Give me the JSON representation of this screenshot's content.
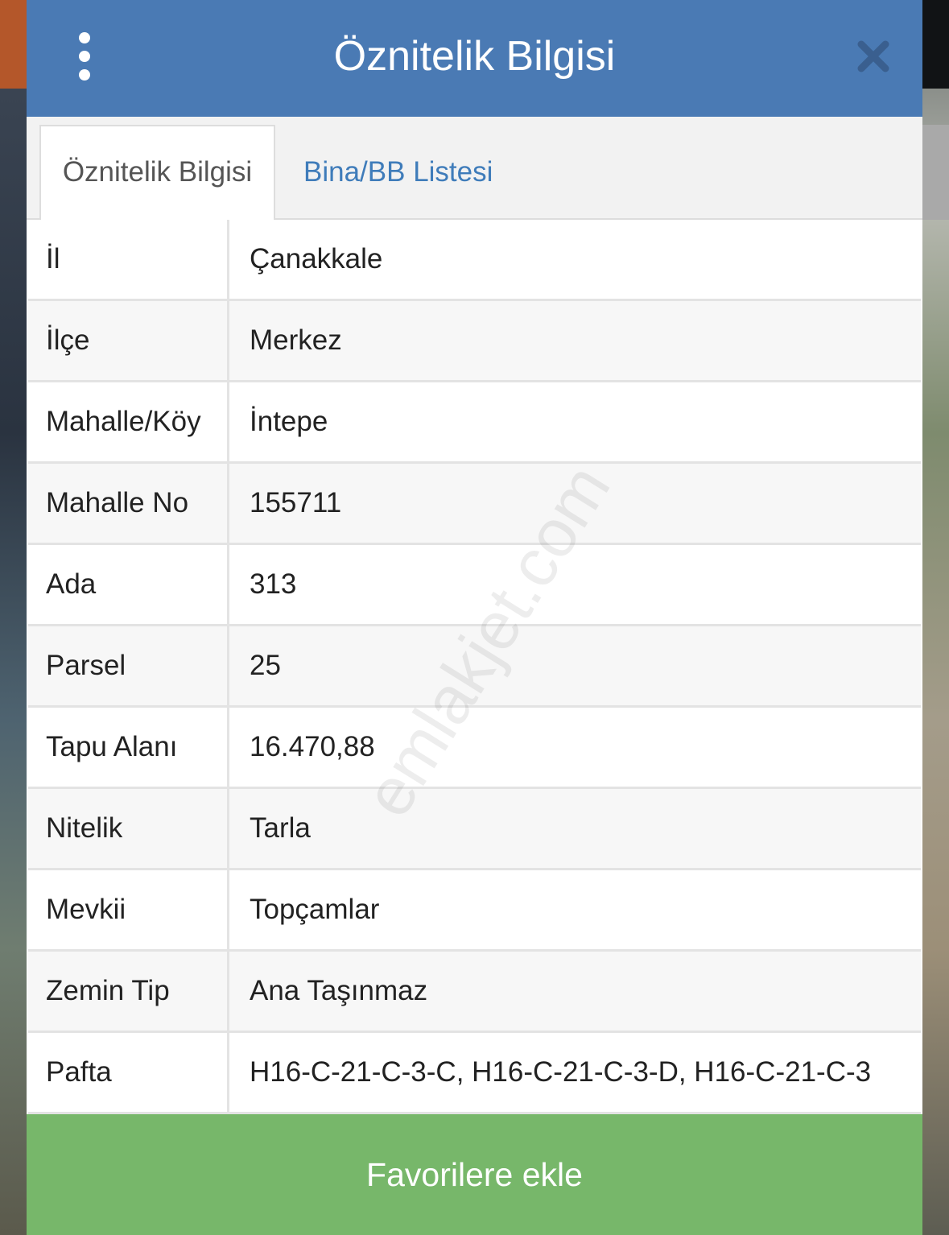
{
  "header": {
    "title": "Öznitelik Bilgisi",
    "menu_icon": "more-vertical-icon",
    "close_icon": "close-icon"
  },
  "tabs": [
    {
      "label": "Öznitelik Bilgisi",
      "active": true
    },
    {
      "label": "Bina/BB Listesi",
      "active": false
    }
  ],
  "rows": [
    {
      "key": "İl",
      "value": "Çanakkale"
    },
    {
      "key": "İlçe",
      "value": "Merkez"
    },
    {
      "key": "Mahalle/Köy",
      "value": "İntepe"
    },
    {
      "key": "Mahalle No",
      "value": "155711"
    },
    {
      "key": "Ada",
      "value": "313"
    },
    {
      "key": "Parsel",
      "value": "25"
    },
    {
      "key": "Tapu Alanı",
      "value": "16.470,88"
    },
    {
      "key": "Nitelik",
      "value": "Tarla"
    },
    {
      "key": "Mevkii",
      "value": "Topçamlar"
    },
    {
      "key": "Zemin Tip",
      "value": "Ana Taşınmaz"
    },
    {
      "key": "Pafta",
      "value": "H16-C-21-C-3-C, H16-C-21-C-3-D, H16-C-21-C-3"
    }
  ],
  "favorite_button": {
    "label": "Favorilere ekle"
  },
  "watermark": "emlakjet.com",
  "colors": {
    "header": "#4a7ab4",
    "tab_link": "#3f7cba",
    "button": "#77b76a"
  }
}
